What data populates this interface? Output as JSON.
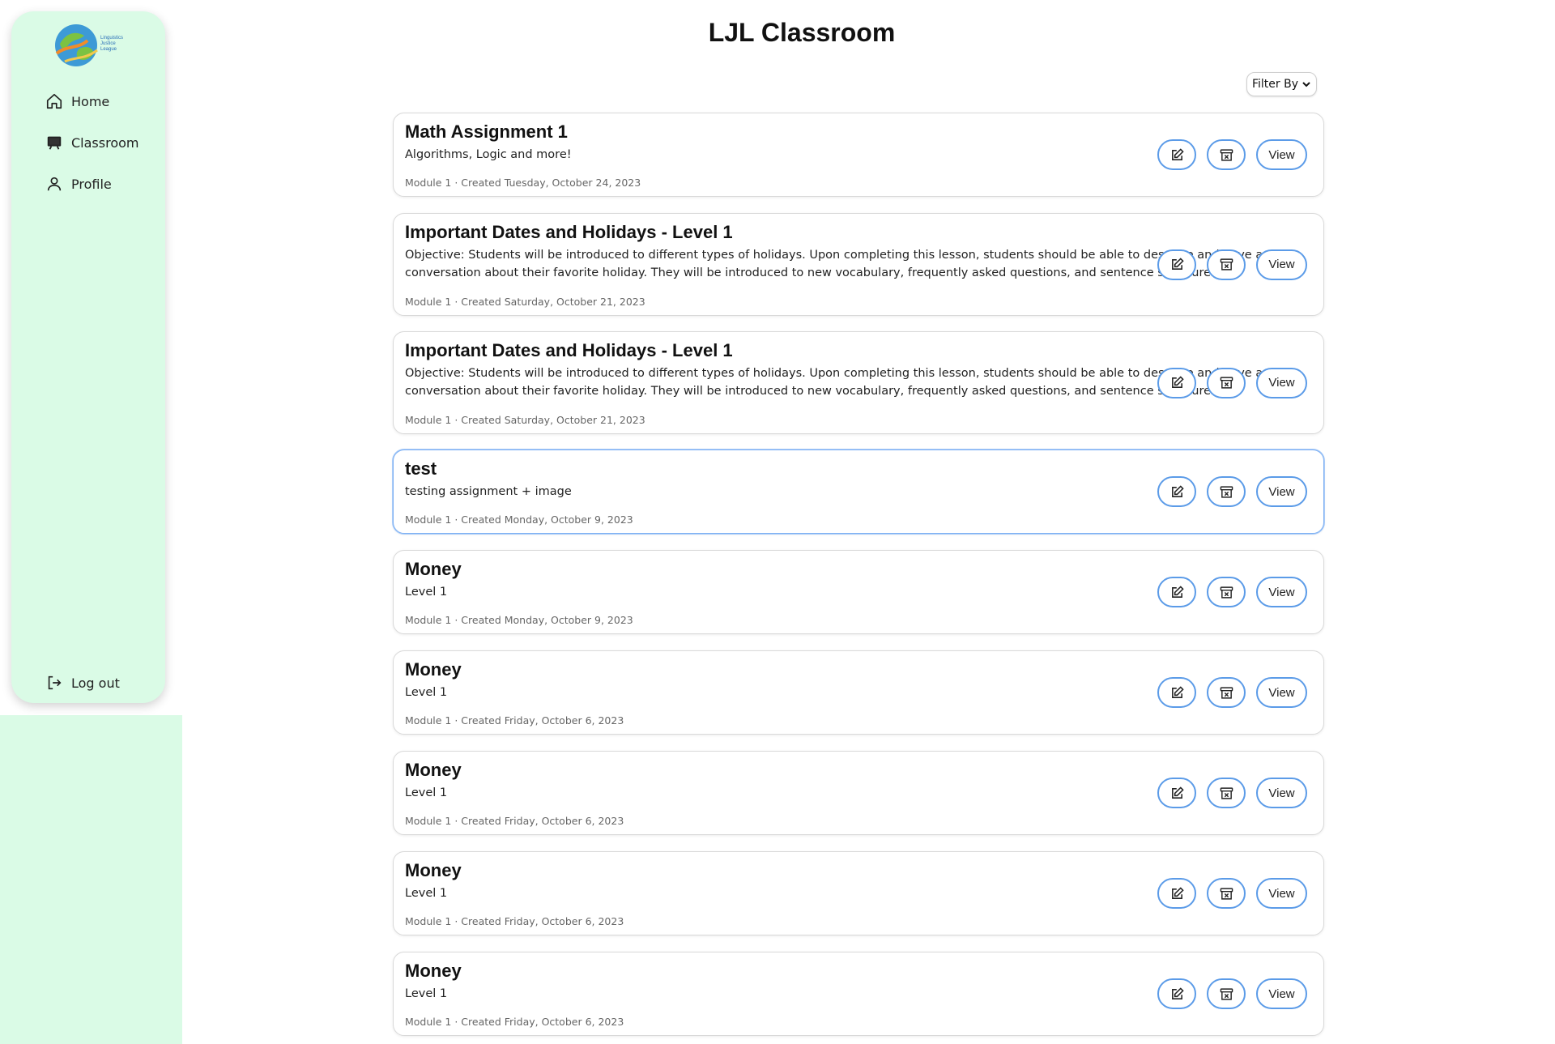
{
  "sidebar": {
    "logo_text": [
      "Linguistics",
      "Justice",
      "League"
    ],
    "items": [
      {
        "label": "Home",
        "icon": "home-icon"
      },
      {
        "label": "Classroom",
        "icon": "classroom-icon"
      },
      {
        "label": "Profile",
        "icon": "user-icon"
      }
    ],
    "logout_label": "Log out"
  },
  "header": {
    "title": "LJL Classroom",
    "filter_label": "Filter By"
  },
  "actions": {
    "view_label": "View"
  },
  "colors": {
    "sidebar_bg": "#dafbe6",
    "accent": "#5b9be8"
  },
  "cards": [
    {
      "title": "Math Assignment 1",
      "description": "Algorithms, Logic and more!",
      "meta": "Module 1 · Created Tuesday, October 24, 2023"
    },
    {
      "title": "Important Dates and Holidays - Level 1",
      "description": "Objective: Students will be introduced to different types of holidays. Upon completing this lesson, students should be able to describe and have a conversation about their favorite holiday. They will be introduced to new vocabulary, frequently asked questions, and sentence structures.",
      "meta": "Module 1 · Created Saturday, October 21, 2023"
    },
    {
      "title": "Important Dates and Holidays - Level 1",
      "description": "Objective: Students will be introduced to different types of holidays. Upon completing this lesson, students should be able to describe and have a conversation about their favorite holiday. They will be introduced to new vocabulary, frequently asked questions, and sentence structures.",
      "meta": "Module 1 · Created Saturday, October 21, 2023"
    },
    {
      "title": "test",
      "description": "testing assignment + image",
      "meta": "Module 1 · Created Monday, October 9, 2023"
    },
    {
      "title": "Money",
      "description": "Level 1",
      "meta": "Module 1 · Created Monday, October 9, 2023"
    },
    {
      "title": "Money",
      "description": "Level 1",
      "meta": "Module 1 · Created Friday, October 6, 2023"
    },
    {
      "title": "Money",
      "description": "Level 1",
      "meta": "Module 1 · Created Friday, October 6, 2023"
    },
    {
      "title": "Money",
      "description": "Level 1",
      "meta": "Module 1 · Created Friday, October 6, 2023"
    },
    {
      "title": "Money",
      "description": "Level 1",
      "meta": "Module 1 · Created Friday, October 6, 2023"
    }
  ]
}
